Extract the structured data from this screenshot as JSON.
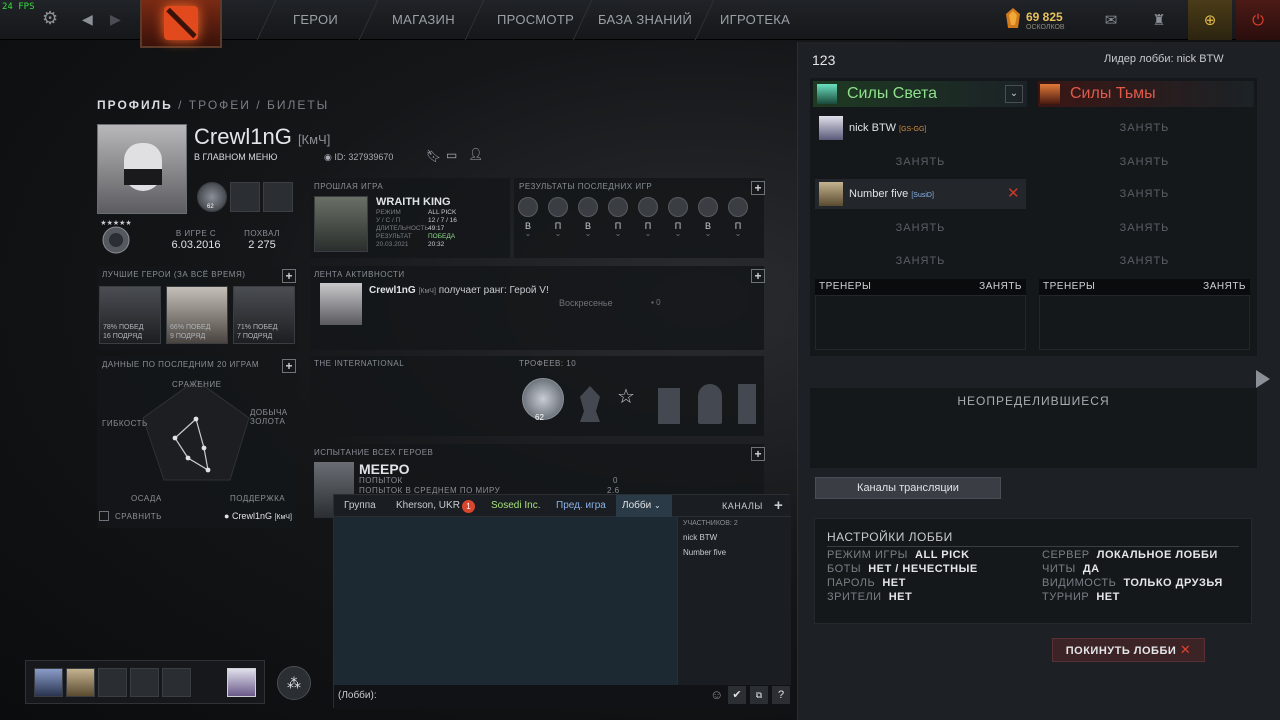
{
  "fps": "24 FPS",
  "nav": [
    "ГЕРОИ",
    "МАГАЗИН",
    "ПРОСМОТР",
    "БАЗА ЗНАНИЙ",
    "ИГРОТЕКА"
  ],
  "shards": {
    "value": "69 825",
    "label": "ОСКОЛКОВ"
  },
  "colors": {
    "accent_gold": "#e6b33c",
    "radiant": "#8ee08a",
    "dire": "#e05a4a",
    "danger": "#e04030"
  },
  "profile": {
    "tabs": [
      "ПРОФИЛЬ",
      "/",
      "ТРОФЕИ",
      "/",
      "БИЛЕТЫ"
    ],
    "name": "Crewl1nG",
    "tag": "[КмЧ]",
    "status": "В ГЛАВНОМ МЕНЮ",
    "id_text": "ID: 327939670",
    "badge_count": "62",
    "since_label": "В ИГРЕ С",
    "since_value": "6.03.2016",
    "commend_label": "ПОХВАЛ",
    "commend_value": "2 275"
  },
  "last_match": {
    "title": "ПРОШЛАЯ ИГРА",
    "hero": "WRAITH KING",
    "rows": [
      {
        "k": "РЕЖИМ",
        "v": "ALL PICK"
      },
      {
        "k": "У / С / П",
        "v": "12 / 7 / 16"
      },
      {
        "k": "ДЛИТЕЛЬНОСТЬ",
        "v": "49:17"
      },
      {
        "k": "РЕЗУЛЬТАТ",
        "v": "ПОБЕДА"
      },
      {
        "k": "20.03.2021",
        "v": "20:32"
      }
    ]
  },
  "recent": {
    "title": "РЕЗУЛЬТАТЫ ПОСЛЕДНИХ ИГР",
    "results": [
      "В",
      "П",
      "В",
      "П",
      "П",
      "П",
      "В",
      "П"
    ]
  },
  "best_heroes": {
    "title": "ЛУЧШИЕ ГЕРОИ (ЗА ВСЁ ВРЕМЯ)",
    "cards": [
      {
        "line1": "78% ПОБЕД",
        "line2": "16 ПОДРЯД"
      },
      {
        "line1": "66% ПОБЕД",
        "line2": "9 ПОДРЯД"
      },
      {
        "line1": "71% ПОБЕД",
        "line2": "7 ПОДРЯД"
      }
    ]
  },
  "activity": {
    "title": "ЛЕНТА АКТИВНОСТИ",
    "user": "Crewl1nG",
    "tag": "[КмЧ]",
    "text": "получает ранг: Герой V!",
    "day": "Воскресенье",
    "likes": "0"
  },
  "stats20": {
    "title": "ДАННЫЕ ПО ПОСЛЕДНИМ 20 ИГРАМ",
    "axes": {
      "top": "СРАЖЕНИЕ",
      "right_top": "ДОБЫЧА ЗОЛОТА",
      "left": "ГИБКОСТЬ",
      "bottom_left": "ОСАДА",
      "bottom_right": "ПОДДЕРЖКА"
    },
    "compare": "СРАВНИТЬ",
    "legend_name": "Crewl1nG",
    "legend_tag": "[КмЧ]"
  },
  "ti": {
    "title": "THE INTERNATIONAL",
    "trophies": "ТРОФЕЕВ: 10",
    "trophy_level": "62"
  },
  "challenge": {
    "title": "ИСПЫТАНИЕ ВСЕХ ГЕРОЕВ",
    "hero": "MEEPO",
    "rows": [
      {
        "k": "ПОПЫТОК",
        "v": "0"
      },
      {
        "k": "ПОПЫТОК В СРЕДНЕМ ПО МИРУ",
        "v": "2.6"
      }
    ]
  },
  "chat": {
    "tabs": [
      "Группа",
      "Kherson, UKR",
      "Sosedi Inc.",
      "Пред. игра",
      "Лобби"
    ],
    "badge": "1",
    "channels": "КАНАЛЫ",
    "members_title": "УЧАСТНИКОВ: 2",
    "members": [
      "nick BTW",
      "Number five"
    ],
    "input_prefix": "(Лобби):"
  },
  "lobby": {
    "name": "123",
    "leader": "Лидер лобби: nick BTW",
    "radiant": "Силы Света",
    "dire": "Силы Тьмы",
    "take": "ЗАНЯТЬ",
    "radiant_players": [
      {
        "name": "nick BTW",
        "tag": "[GS-GG]"
      },
      null,
      {
        "name": "Number five",
        "tag": "[SusiD]"
      },
      null,
      null
    ],
    "coaches": "ТРЕНЕРЫ",
    "unassigned": "НЕОПРЕДЕЛИВШИЕСЯ",
    "broadcast": "Каналы трансляции",
    "settings_title": "НАСТРОЙКИ ЛОББИ",
    "settings_left": [
      {
        "k": "РЕЖИМ ИГРЫ",
        "v": "ALL PICK"
      },
      {
        "k": "БОТЫ",
        "v": "НЕТ / НЕЧЕСТНЫЕ"
      },
      {
        "k": "ПАРОЛЬ",
        "v": "НЕТ"
      },
      {
        "k": "ЗРИТЕЛИ",
        "v": "НЕТ"
      }
    ],
    "settings_right": [
      {
        "k": "СЕРВЕР",
        "v": "ЛОКАЛЬНОЕ ЛОББИ"
      },
      {
        "k": "ЧИТЫ",
        "v": "ДА"
      },
      {
        "k": "ВИДИМОСТЬ",
        "v": "ТОЛЬКО ДРУЗЬЯ"
      },
      {
        "k": "ТУРНИР",
        "v": "НЕТ"
      }
    ],
    "leave": "ПОКИНУТЬ ЛОББИ"
  }
}
